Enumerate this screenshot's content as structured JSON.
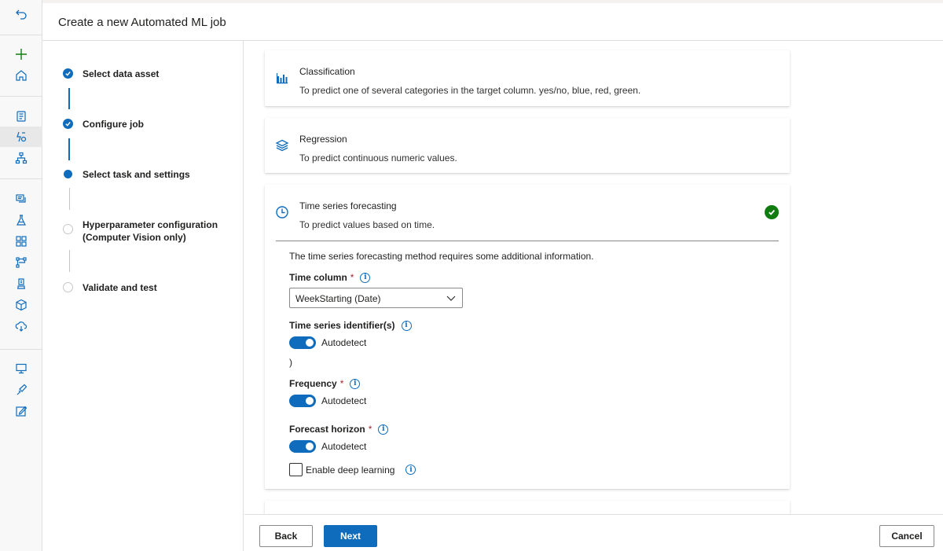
{
  "header": {
    "title": "Create a new Automated ML job"
  },
  "steps": [
    {
      "label": "Select data asset",
      "state": "done"
    },
    {
      "label": "Configure job",
      "state": "done"
    },
    {
      "label": "Select task and settings",
      "state": "current"
    },
    {
      "label": "Hyperparameter configuration\n(Computer Vision only)",
      "state": "todo"
    },
    {
      "label": "Validate and test",
      "state": "todo"
    }
  ],
  "tasks": {
    "classification": {
      "title": "Classification",
      "desc": "To predict one of several categories in the target column. yes/no, blue, red, green.",
      "icon": "bar-chart-icon"
    },
    "regression": {
      "title": "Regression",
      "desc": "To predict continuous numeric values.",
      "icon": "layers-icon"
    },
    "forecasting": {
      "title": "Time series forecasting",
      "desc": "To predict values based on time.",
      "icon": "clock-icon",
      "selected": true
    }
  },
  "forecast_settings": {
    "intro": "The time series forecasting method requires some additional information.",
    "time_column_label": "Time column",
    "time_column_value": "WeekStarting (Date)",
    "identifiers_label": "Time series identifier(s)",
    "identifiers_toggle": "Autodetect",
    "stray_text": ")",
    "frequency_label": "Frequency",
    "frequency_toggle": "Autodetect",
    "horizon_label": "Forecast horizon",
    "horizon_toggle": "Autodetect",
    "deep_learning_label": "Enable deep learning",
    "required_mark": "*",
    "info_glyph": "i"
  },
  "footer": {
    "back": "Back",
    "next": "Next",
    "cancel": "Cancel"
  },
  "colors": {
    "accent": "#0f6cbd",
    "success": "#107c10",
    "required": "#a4262c"
  }
}
